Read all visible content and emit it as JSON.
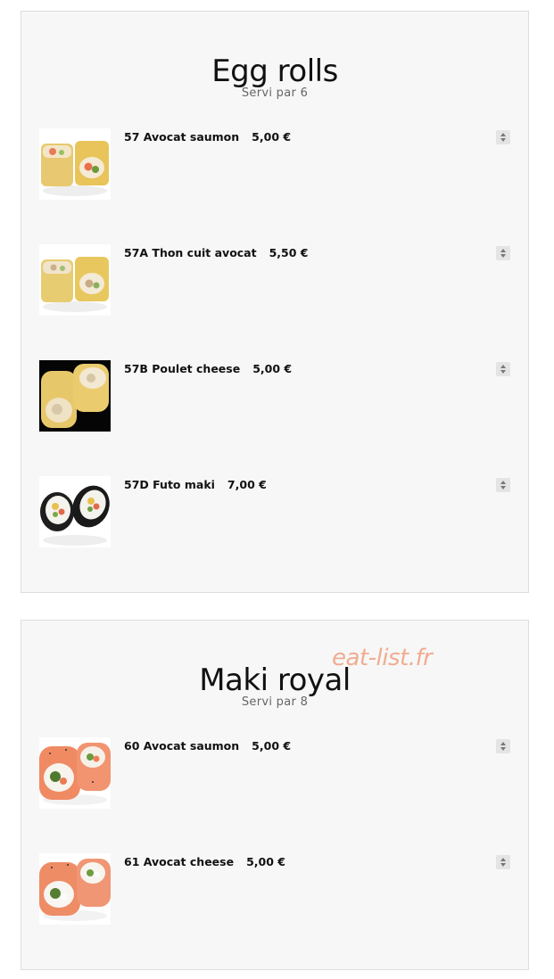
{
  "sections": [
    {
      "title": "Egg rolls",
      "subtitle": "Servi par 6",
      "items": [
        {
          "name": "57 Avocat saumon",
          "price": "5,00 €",
          "image": "egg-roll-salmon-avocado"
        },
        {
          "name": "57A Thon cuit avocat",
          "price": "5,50 €",
          "image": "egg-roll-tuna-avocado"
        },
        {
          "name": "57B Poulet cheese",
          "price": "5,00 €",
          "image": "egg-roll-chicken-cheese"
        },
        {
          "name": "57D Futo maki",
          "price": "7,00 €",
          "image": "futo-maki"
        }
      ]
    },
    {
      "title": "Maki royal",
      "subtitle": "Servi par 8",
      "watermark": "eat-list.fr",
      "items": [
        {
          "name": "60 Avocat saumon",
          "price": "5,00 €",
          "image": "maki-royal-salmon-avocado"
        },
        {
          "name": "61 Avocat cheese",
          "price": "5,00 €",
          "image": "maki-royal-avocado-cheese"
        }
      ]
    }
  ],
  "icons": {
    "quantity": "quantity-spinner-icon"
  },
  "colors": {
    "card_background": "#f7f7f7",
    "card_border": "#dddddd",
    "watermark": "#f0a080"
  }
}
